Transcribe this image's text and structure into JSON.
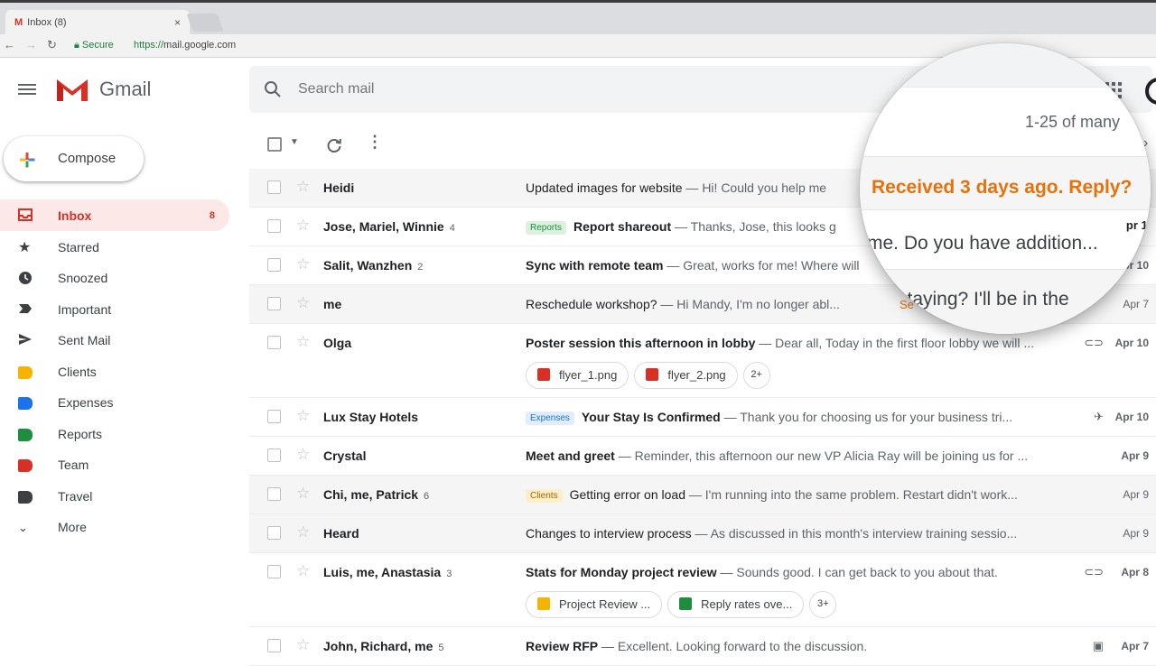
{
  "browser": {
    "tab_title": "Inbox (8)",
    "tab_close": "×",
    "secure_label": "Secure",
    "url_scheme": "https://",
    "url_host": "mail.google.com"
  },
  "app": {
    "brand": "Gmail",
    "search_placeholder": "Search mail",
    "compose_label": "Compose",
    "pagination": "1-25 of many"
  },
  "sidebar": {
    "items": [
      {
        "label": "Inbox",
        "count": "8",
        "icon": "inbox-icon"
      },
      {
        "label": "Starred",
        "icon": "star-icon"
      },
      {
        "label": "Snoozed",
        "icon": "clock-icon"
      },
      {
        "label": "Important",
        "icon": "important-icon"
      },
      {
        "label": "Sent Mail",
        "icon": "send-icon"
      },
      {
        "label": "Clients",
        "icon": "label-icon",
        "color": "#f4b400"
      },
      {
        "label": "Expenses",
        "icon": "label-icon",
        "color": "#1a73e8"
      },
      {
        "label": "Reports",
        "icon": "label-icon",
        "color": "#1e8e3e"
      },
      {
        "label": "Team",
        "icon": "label-icon",
        "color": "#d93025"
      },
      {
        "label": "Travel",
        "icon": "label-icon",
        "color": "#3c4043"
      },
      {
        "label": "More",
        "icon": "chevron-down-icon"
      }
    ]
  },
  "emails": [
    {
      "from": "Heidi",
      "subject": "Updated images for website",
      "snippet": " — Hi! Could you help me",
      "date": "",
      "state": "read"
    },
    {
      "from": "Jose, Mariel, Winnie",
      "count": "4",
      "tag": "Reports",
      "subject": "Report shareout",
      "snippet": " — Thanks, Jose, this looks g",
      "date": "",
      "state": "unread"
    },
    {
      "from": "Salit, Wanzhen",
      "count": "2",
      "subject": "Sync with remote team",
      "snippet": " — Great, works for me! Where will",
      "date": "Apr 10",
      "state": "unread"
    },
    {
      "from": "me",
      "subject": "Reschedule workshop?",
      "snippet": " — Hi Mandy, I'm no longer abl...",
      "date": "Apr 7",
      "state": "read",
      "right_text": "Se"
    },
    {
      "from": "Olga",
      "subject": "Poster session this afternoon in lobby",
      "snippet": " — Dear all, Today in the first floor lobby we will ...",
      "date": "Apr 10",
      "state": "unread",
      "attachments": [
        "flyer_1.png",
        "flyer_2.png"
      ],
      "more": "2+"
    },
    {
      "from": "Lux Stay Hotels",
      "tag": "Expenses",
      "subject": "Your Stay Is Confirmed",
      "snippet": " — Thank you for choosing us for your business tri...",
      "date": "Apr 10",
      "state": "unread"
    },
    {
      "from": "Crystal",
      "subject": "Meet and greet",
      "snippet": " — Reminder, this afternoon our new VP Alicia Ray will be joining us for ...",
      "date": "Apr 9",
      "state": "unread"
    },
    {
      "from": "Chi, me, Patrick",
      "count": "6",
      "tag": "Clients",
      "subject": "Getting error on load",
      "snippet": " — I'm running into the same problem. Restart didn't work...",
      "date": "Apr 9",
      "state": "read"
    },
    {
      "from": "Heard",
      "subject": "Changes to interview process",
      "snippet": " — As discussed in this month's interview training sessio...",
      "date": "Apr 9",
      "state": "read"
    },
    {
      "from": "Luis, me, Anastasia",
      "count": "3",
      "subject": "Stats for Monday project review",
      "snippet": " — Sounds good. I can get back to you about that.",
      "date": "Apr 8",
      "state": "unread",
      "attachments": [
        "Project Review ...",
        "Reply rates ove..."
      ],
      "more": "3+"
    },
    {
      "from": "John, Richard, me",
      "count": "5",
      "subject": "Review RFP",
      "snippet": " — Excellent. Looking forward to the discussion.",
      "date": "Apr 7",
      "state": "unread"
    }
  ],
  "magnifier": {
    "pagination": "1-25 of many",
    "nudge": "Received 3 days ago. Reply?",
    "snippet_1": "me. Do you have addition...",
    "snippet_2": "staying? I'll be in the",
    "date_edge": "pr 10"
  },
  "tag_colors": {
    "Reports": {
      "bg": "#ddf1e1",
      "fg": "#1e8e3e"
    },
    "Expenses": {
      "bg": "#e1ecfd",
      "fg": "#1a73e8"
    },
    "Clients": {
      "bg": "#fdf0c8",
      "fg": "#b06000"
    }
  }
}
